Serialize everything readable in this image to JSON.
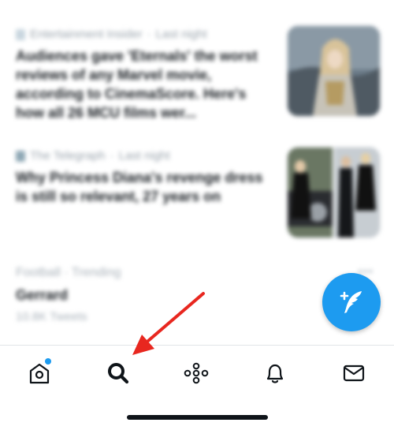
{
  "feed": {
    "stories": [
      {
        "source": "Entertainment Insider",
        "time": "Last night",
        "headline": "Audiences gave 'Eternals' the worst reviews of any Marvel movie, according to CinemaScore. Here's how all 26 MCU films wer..."
      },
      {
        "source": "The Telegraph",
        "time": "Last night",
        "headline": "Why Princess Diana's revenge dress is still so relevant, 27 years on"
      }
    ],
    "trend": {
      "category": "Football · Trending",
      "name": "Gerrard",
      "count": "10.8K Tweets"
    }
  },
  "fab": {
    "icon": "compose-tweet-icon",
    "color": "#1d9bf0"
  },
  "tabbar": {
    "tabs": [
      {
        "name": "home",
        "icon": "home-icon",
        "badge": true
      },
      {
        "name": "search",
        "icon": "search-icon",
        "active": true
      },
      {
        "name": "spaces",
        "icon": "spaces-icon"
      },
      {
        "name": "notifications",
        "icon": "bell-icon"
      },
      {
        "name": "messages",
        "icon": "mail-icon"
      }
    ]
  },
  "annotation": {
    "type": "red-arrow",
    "points_to": "search-icon",
    "color": "#e8271f"
  },
  "colors": {
    "accent": "#1d9bf0",
    "text": "#0f1419",
    "muted": "#9aa4ad"
  }
}
